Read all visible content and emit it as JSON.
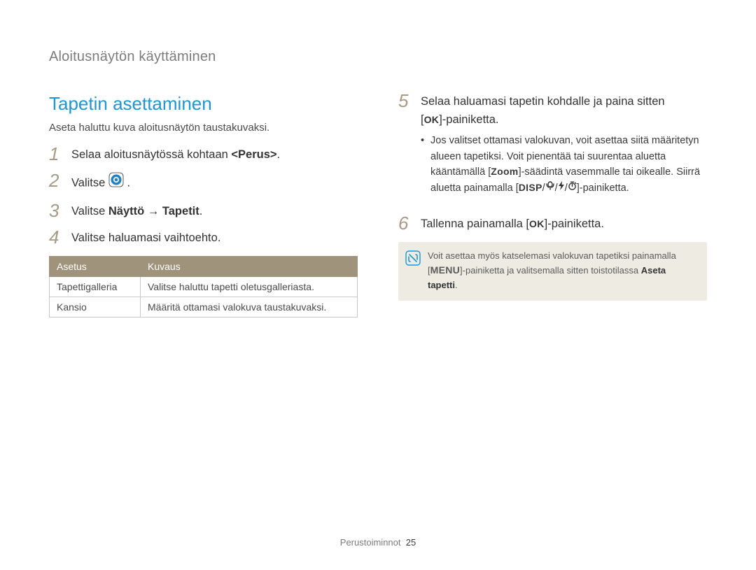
{
  "breadcrumb": "Aloitusnäytön käyttäminen",
  "heading": "Tapetin asettaminen",
  "intro": "Aseta haluttu kuva aloitusnäytön taustakuvaksi.",
  "steps_left": {
    "1": {
      "num": "1",
      "text_a": "Selaa aloitusnäytössä kohtaan ",
      "bold": "<Perus>",
      "text_b": "."
    },
    "2": {
      "num": "2",
      "text_a": "Valitse ",
      "text_b": "."
    },
    "3": {
      "num": "3",
      "text_a": "Valitse ",
      "bold1": "Näyttö",
      "arrow": " → ",
      "bold2": "Tapetit",
      "text_b": "."
    },
    "4": {
      "num": "4",
      "text": "Valitse haluamasi vaihtoehto."
    }
  },
  "table": {
    "headers": {
      "c1": "Asetus",
      "c2": "Kuvaus"
    },
    "rows": [
      {
        "c1": "Tapettigalleria",
        "c2": "Valitse haluttu tapetti oletusgalleriasta."
      },
      {
        "c1": "Kansio",
        "c2": "Määritä ottamasi valokuva taustakuvaksi."
      }
    ]
  },
  "steps_right": {
    "5": {
      "num": "5",
      "line1": "Selaa haluamasi tapetin kohdalle ja paina sitten",
      "line2_prefix": "[",
      "line2_suffix": "]-painiketta.",
      "sub": {
        "a": "Jos valitset ottamasi valokuvan, voit asettaa siitä määritetyn alueen tapetiksi. Voit pienentää tai suurentaa aluetta kääntämällä [",
        "zoom": "Zoom",
        "b": "]-säädintä vasemmalle tai oikealle. Siirrä aluetta painamalla [",
        "disp": "DISP",
        "c": "]-painiketta."
      }
    },
    "6": {
      "num": "6",
      "text_a": "Tallenna painamalla [",
      "text_b": "]-painiketta."
    }
  },
  "note": {
    "line1": "Voit asettaa myös katselemasi valokuvan tapetiksi painamalla",
    "prefix": "[",
    "menu": "MENU",
    "mid": "]-painiketta ja valitsemalla sitten toistotilassa ",
    "bold": "Aseta tapetti",
    "suffix": "."
  },
  "footer": {
    "section": "Perustoiminnot",
    "page": "25"
  },
  "labels": {
    "ok": "OK",
    "disp": "DISP",
    "menu": "MENU",
    "zoom": "Zoom"
  }
}
